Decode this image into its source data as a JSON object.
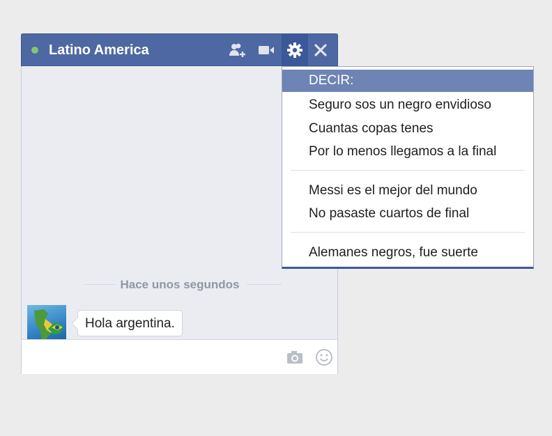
{
  "chat": {
    "title": "Latino America",
    "status_color": "#84c56f",
    "header_color": "#4d68a2",
    "icons": [
      "add-friend-icon",
      "video-call-icon",
      "gear-icon",
      "close-icon"
    ]
  },
  "messages": {
    "timestamp": "Hace unos segundos",
    "items": [
      {
        "text": "Hola argentina."
      }
    ]
  },
  "composer": {
    "placeholder": "",
    "icons": [
      "camera-icon",
      "emoji-icon"
    ]
  },
  "menu": {
    "header": "DECIR:",
    "groups": [
      [
        "Seguro sos un negro envidioso",
        "Cuantas copas tenes",
        "Por lo menos llegamos a la final"
      ],
      [
        "Messi es el mejor del mundo",
        "No pasaste cuartos de final"
      ],
      [
        "Alemanes negros, fue suerte"
      ]
    ],
    "highlight_color": "#6d84b4"
  }
}
